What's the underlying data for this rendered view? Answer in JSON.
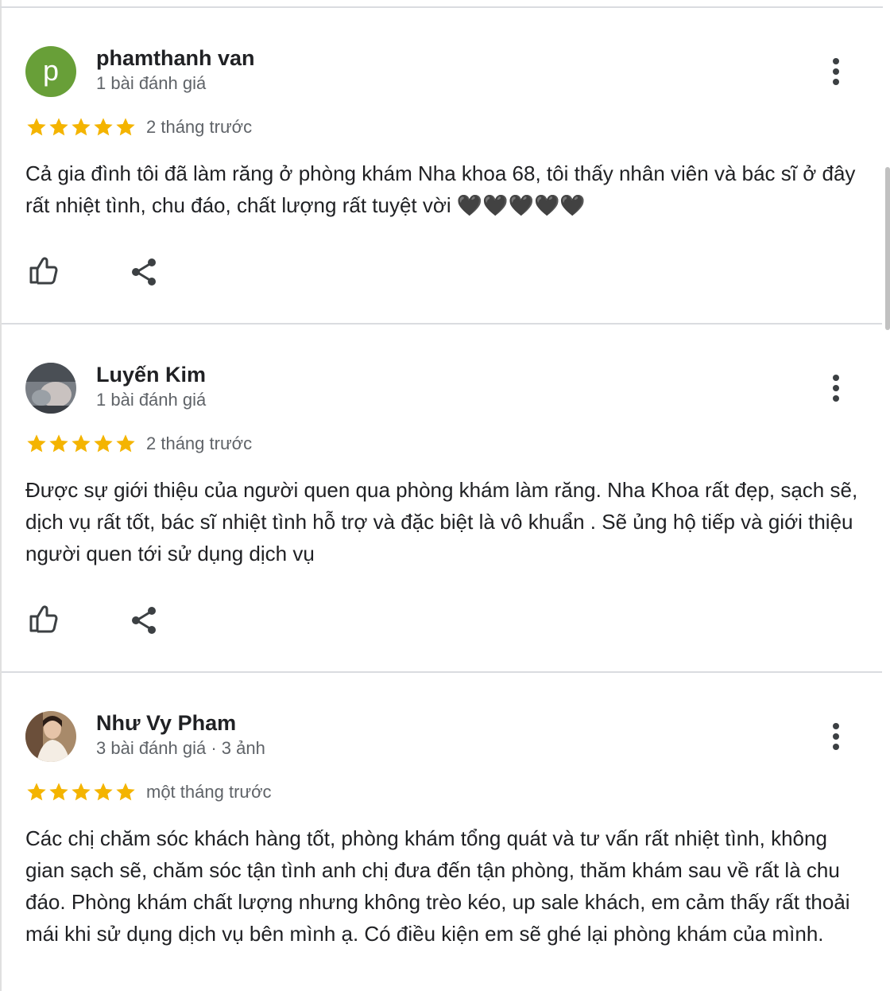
{
  "reviews": [
    {
      "name": "phamthanh van",
      "meta": "1 bài đánh giá",
      "avatar_letter": "p",
      "rating": 5,
      "time": "2 tháng trước",
      "text": "Cả gia đình tôi đã làm răng ở phòng khám Nha khoa 68, tôi thấy nhân viên và bác sĩ ở đây rất nhiệt tình, chu đáo, chất lượng rất tuyệt vời 🖤🖤🖤🖤🖤"
    },
    {
      "name": "Luyến Kim",
      "meta": "1 bài đánh giá",
      "rating": 5,
      "time": "2 tháng trước",
      "text": "Được sự giới thiệu của người quen qua phòng khám làm răng. Nha Khoa rất đẹp, sạch sẽ, dịch vụ rất tốt, bác sĩ nhiệt tình hỗ trợ và đặc biệt là vô khuẩn . Sẽ ủng hộ tiếp và giới thiệu người quen tới sử dụng dịch vụ"
    },
    {
      "name": "Như Vy Pham",
      "meta": "3 bài đánh giá · 3 ảnh",
      "rating": 5,
      "time": "một tháng trước",
      "text": "Các chị chăm sóc khách hàng tốt, phòng khám tổng quát và tư vấn rất nhiệt tình, không gian sạch sẽ, chăm sóc tận tình anh chị đưa đến tận phòng, thăm khám sau về rất là chu đáo. Phòng khám chất lượng nhưng không trèo kéo, up sale khách, em cảm thấy rất thoải mái khi sử dụng dịch vụ bên mình ạ. Có điều kiện em sẽ ghé lại phòng khám của mình."
    }
  ],
  "colors": {
    "star": "#f4b400",
    "avatar_p": "#689f38",
    "icon": "#3c4043"
  },
  "icons": {
    "like": "thumb-up-icon",
    "share": "share-icon",
    "more": "more-vert-icon",
    "star": "star-icon"
  }
}
